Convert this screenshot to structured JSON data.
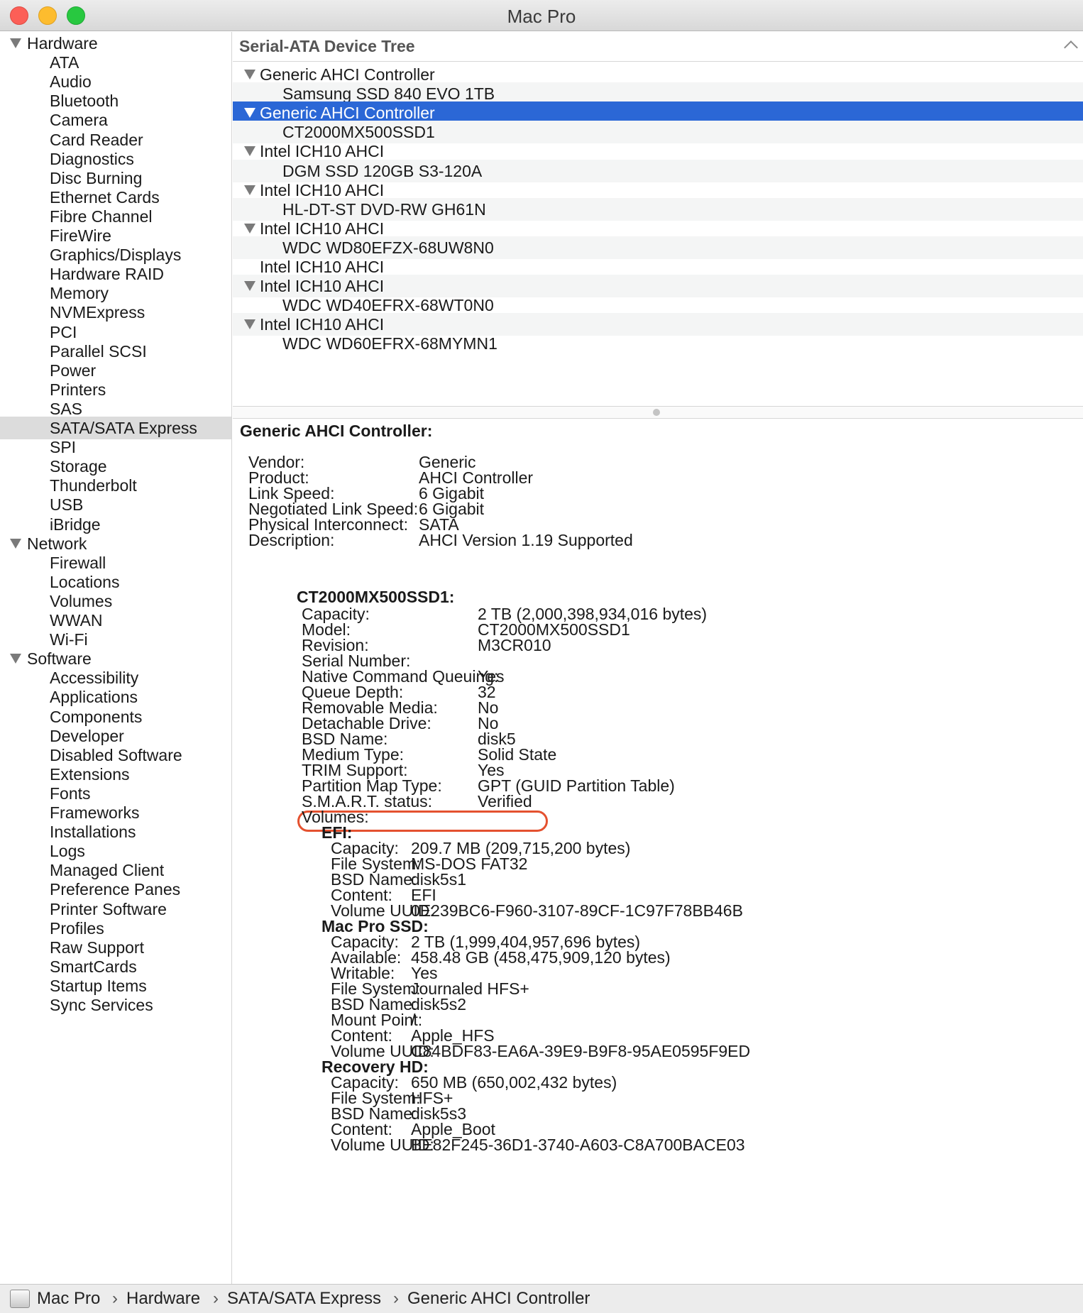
{
  "window": {
    "title": "Mac Pro"
  },
  "sidebar": {
    "groups": [
      {
        "label": "Hardware",
        "items": [
          "ATA",
          "Audio",
          "Bluetooth",
          "Camera",
          "Card Reader",
          "Diagnostics",
          "Disc Burning",
          "Ethernet Cards",
          "Fibre Channel",
          "FireWire",
          "Graphics/Displays",
          "Hardware RAID",
          "Memory",
          "NVMExpress",
          "PCI",
          "Parallel SCSI",
          "Power",
          "Printers",
          "SAS",
          "SATA/SATA Express",
          "SPI",
          "Storage",
          "Thunderbolt",
          "USB",
          "iBridge"
        ]
      },
      {
        "label": "Network",
        "items": [
          "Firewall",
          "Locations",
          "Volumes",
          "WWAN",
          "Wi-Fi"
        ]
      },
      {
        "label": "Software",
        "items": [
          "Accessibility",
          "Applications",
          "Components",
          "Developer",
          "Disabled Software",
          "Extensions",
          "Fonts",
          "Frameworks",
          "Installations",
          "Logs",
          "Managed Client",
          "Preference Panes",
          "Printer Software",
          "Profiles",
          "Raw Support",
          "SmartCards",
          "Startup Items",
          "Sync Services"
        ]
      }
    ],
    "selected": "SATA/SATA Express"
  },
  "tree": {
    "header": "Serial-ATA Device Tree",
    "rows": [
      {
        "label": "Generic AHCI Controller",
        "kind": "controller",
        "expanded": true
      },
      {
        "label": "Samsung SSD 840 EVO 1TB",
        "kind": "device"
      },
      {
        "label": "Generic AHCI Controller",
        "kind": "controller",
        "expanded": true,
        "selected": true
      },
      {
        "label": "CT2000MX500SSD1",
        "kind": "device"
      },
      {
        "label": "Intel ICH10 AHCI",
        "kind": "controller",
        "expanded": true
      },
      {
        "label": "DGM SSD 120GB S3-120A",
        "kind": "device"
      },
      {
        "label": "Intel ICH10 AHCI",
        "kind": "controller",
        "expanded": true
      },
      {
        "label": "HL-DT-ST DVD-RW GH61N",
        "kind": "device"
      },
      {
        "label": "Intel ICH10 AHCI",
        "kind": "controller",
        "expanded": true
      },
      {
        "label": "WDC WD80EFZX-68UW8N0",
        "kind": "device"
      },
      {
        "label": "Intel ICH10 AHCI",
        "kind": "controller",
        "expanded": false
      },
      {
        "label": "Intel ICH10 AHCI",
        "kind": "controller",
        "expanded": true
      },
      {
        "label": "WDC WD40EFRX-68WT0N0",
        "kind": "device"
      },
      {
        "label": "Intel ICH10 AHCI",
        "kind": "controller",
        "expanded": true
      },
      {
        "label": "WDC WD60EFRX-68MYMN1",
        "kind": "device"
      }
    ]
  },
  "detail": {
    "title": "Generic AHCI Controller:",
    "controller": [
      [
        "Vendor:",
        "Generic"
      ],
      [
        "Product:",
        "AHCI Controller"
      ],
      [
        "Link Speed:",
        "6 Gigabit"
      ],
      [
        "Negotiated Link Speed:",
        "6 Gigabit"
      ],
      [
        "Physical Interconnect:",
        "SATA"
      ],
      [
        "Description:",
        "AHCI Version 1.19 Supported"
      ]
    ],
    "device_title": "CT2000MX500SSD1:",
    "device": [
      [
        "Capacity:",
        "2 TB (2,000,398,934,016 bytes)"
      ],
      [
        "Model:",
        "CT2000MX500SSD1"
      ],
      [
        "Revision:",
        "M3CR010"
      ],
      [
        "Serial Number:",
        ""
      ],
      [
        "Native Command Queuing:",
        "Yes"
      ],
      [
        "Queue Depth:",
        "32"
      ],
      [
        "Removable Media:",
        "No"
      ],
      [
        "Detachable Drive:",
        "No"
      ],
      [
        "BSD Name:",
        "disk5"
      ],
      [
        "Medium Type:",
        "Solid State"
      ],
      [
        "TRIM Support:",
        "Yes"
      ],
      [
        "Partition Map Type:",
        "GPT (GUID Partition Table)"
      ],
      [
        "S.M.A.R.T. status:",
        "Verified"
      ],
      [
        "Volumes:",
        ""
      ]
    ],
    "volumes": [
      {
        "name": "EFI:",
        "props": [
          [
            "Capacity:",
            "209.7 MB (209,715,200 bytes)"
          ],
          [
            "File System:",
            "MS-DOS FAT32"
          ],
          [
            "BSD Name:",
            "disk5s1"
          ],
          [
            "Content:",
            "EFI"
          ],
          [
            "Volume UUID:",
            "0E239BC6-F960-3107-89CF-1C97F78BB46B"
          ]
        ]
      },
      {
        "name": "Mac Pro SSD:",
        "props": [
          [
            "Capacity:",
            "2 TB (1,999,404,957,696 bytes)"
          ],
          [
            "Available:",
            "458.48 GB (458,475,909,120 bytes)"
          ],
          [
            "Writable:",
            "Yes"
          ],
          [
            "File System:",
            "Journaled HFS+"
          ],
          [
            "BSD Name:",
            "disk5s2"
          ],
          [
            "Mount Point:",
            "/"
          ],
          [
            "Content:",
            "Apple_HFS"
          ],
          [
            "Volume UUID:",
            "C84BDF83-EA6A-39E9-B9F8-95AE0595F9ED"
          ]
        ]
      },
      {
        "name": "Recovery HD:",
        "props": [
          [
            "Capacity:",
            "650 MB (650,002,432 bytes)"
          ],
          [
            "File System:",
            "HFS+"
          ],
          [
            "BSD Name:",
            "disk5s3"
          ],
          [
            "Content:",
            "Apple_Boot"
          ],
          [
            "Volume UUID:",
            "BE82F245-36D1-3740-A603-C8A700BACE03"
          ]
        ]
      }
    ]
  },
  "pathbar": {
    "crumbs": [
      "Mac Pro",
      "Hardware",
      "SATA/SATA Express",
      "Generic AHCI Controller"
    ],
    "separator": "›"
  },
  "colors": {
    "selection": "#2b67d6",
    "highlight_ring": "#e4512f"
  }
}
